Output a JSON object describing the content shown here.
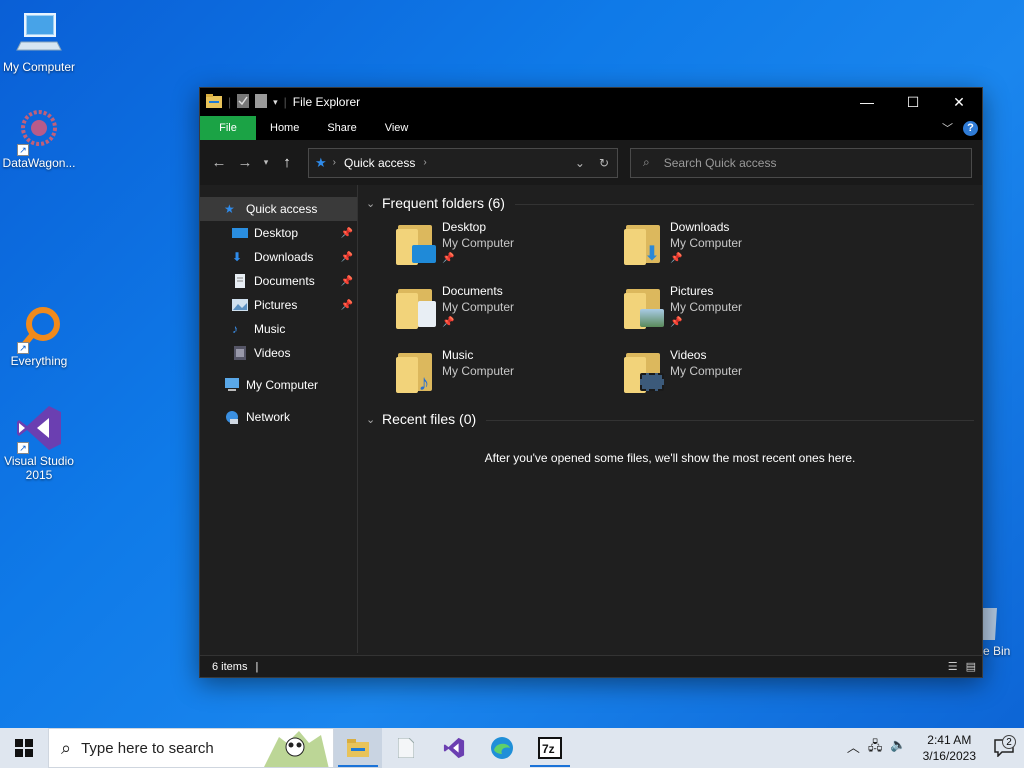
{
  "desktop": {
    "icons": [
      {
        "label": "My Computer"
      },
      {
        "label": "DataWagon..."
      },
      {
        "label": "Everything"
      },
      {
        "label": "Visual Studio 2015"
      }
    ],
    "recycle_partial": "e Bin"
  },
  "window": {
    "title": "File Explorer",
    "controls": {
      "minimize": "—",
      "maximize": "☐",
      "close": "✕"
    },
    "ribbon_tabs": [
      "File",
      "Home",
      "Share",
      "View"
    ],
    "address": {
      "location": "Quick access"
    },
    "search": {
      "placeholder": "Search Quick access"
    }
  },
  "sidebar": {
    "items": [
      {
        "label": "Quick access",
        "icon": "star-icon"
      },
      {
        "label": "Desktop",
        "icon": "desktop-icon",
        "pinned": true
      },
      {
        "label": "Downloads",
        "icon": "download-icon",
        "pinned": true
      },
      {
        "label": "Documents",
        "icon": "document-icon",
        "pinned": true
      },
      {
        "label": "Pictures",
        "icon": "pictures-icon",
        "pinned": true
      },
      {
        "label": "Music",
        "icon": "music-icon"
      },
      {
        "label": "Videos",
        "icon": "video-icon"
      },
      {
        "label": "My Computer",
        "icon": "computer-icon"
      },
      {
        "label": "Network",
        "icon": "network-icon"
      }
    ]
  },
  "content": {
    "frequent_header": "Frequent folders (6)",
    "folders": [
      {
        "name": "Desktop",
        "location": "My Computer",
        "pinned": true,
        "badge": "#1f8ad8"
      },
      {
        "name": "Downloads",
        "location": "My Computer",
        "pinned": true,
        "badge": "#2a88d8"
      },
      {
        "name": "Documents",
        "location": "My Computer",
        "pinned": true,
        "badge": "#e8eef4"
      },
      {
        "name": "Pictures",
        "location": "My Computer",
        "pinned": true,
        "badge": "#7fb0d6"
      },
      {
        "name": "Music",
        "location": "My Computer",
        "pinned": false,
        "badge": "#2a6fd0"
      },
      {
        "name": "Videos",
        "location": "My Computer",
        "pinned": false,
        "badge": "#3c5a7a"
      }
    ],
    "recent_header": "Recent files (0)",
    "recent_empty": "After you've opened some files, we'll show the most recent ones here."
  },
  "status": {
    "items": "6 items"
  },
  "taskbar": {
    "search_placeholder": "Type here to search",
    "clock_time": "2:41 AM",
    "clock_date": "3/16/2023",
    "notif_count": "2"
  },
  "colors": {
    "accent": "#1ba345",
    "help": "#2f7bd6"
  }
}
